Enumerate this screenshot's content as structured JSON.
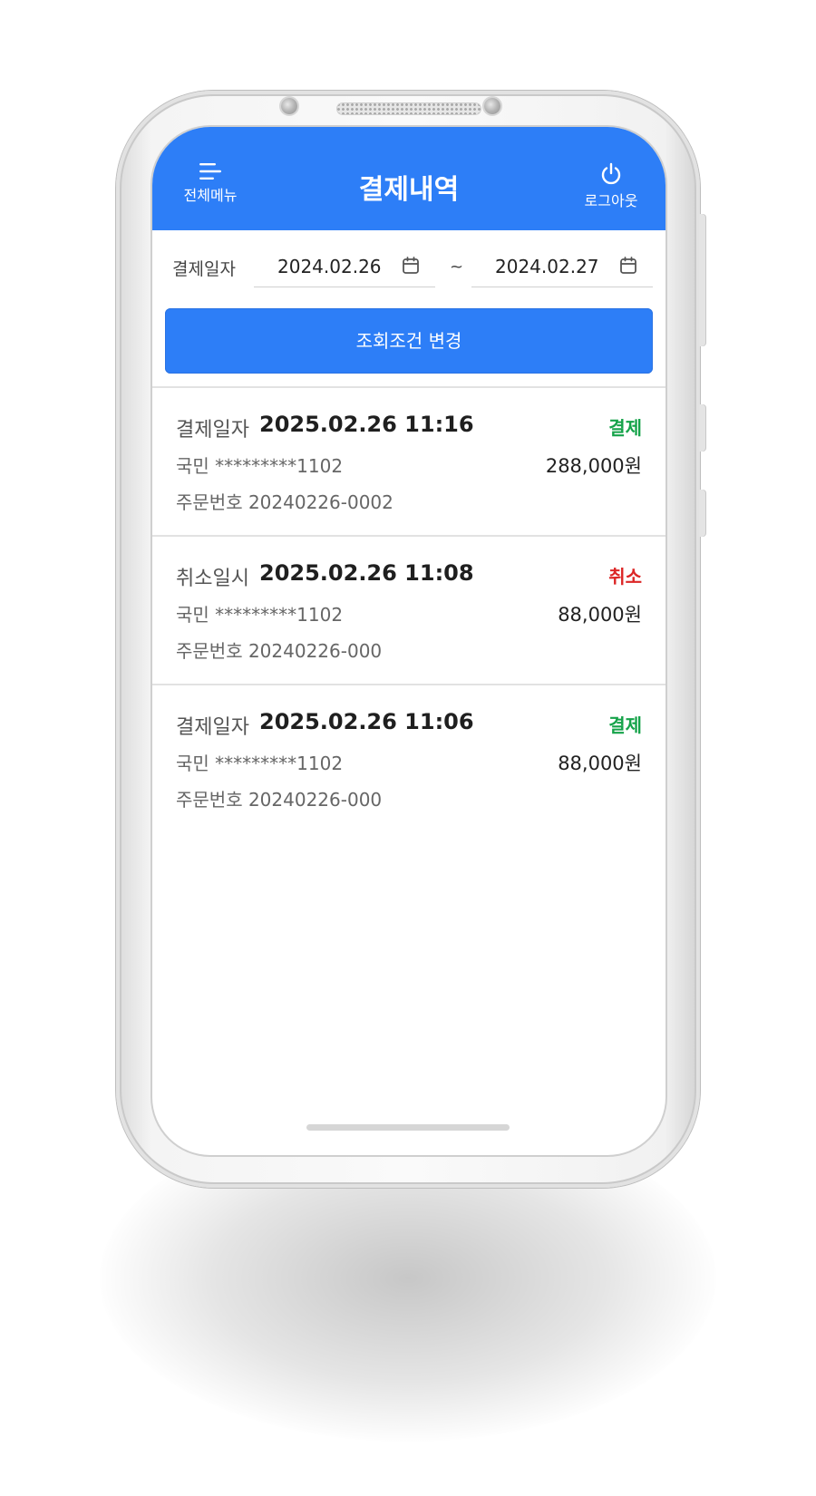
{
  "header": {
    "title": "결제내역",
    "menu_label": "전체메뉴",
    "logout_label": "로그아웃",
    "background_color": "#2d7ef7"
  },
  "filter": {
    "label": "결제일자",
    "date_from": "2024.02.26",
    "separator": "~",
    "date_to": "2024.02.27",
    "search_button_label": "조회조건 변경"
  },
  "transactions": [
    {
      "date_label": "결제일자",
      "datetime": "2025.02.26 11:16",
      "status": "결제",
      "status_color": "#16a34a",
      "card": "국민 *********1102",
      "amount": "288,000원",
      "order": "주문번호 20240226-0002"
    },
    {
      "date_label": "취소일시",
      "datetime": "2025.02.26 11:08",
      "status": "취소",
      "status_color": "#dc2626",
      "card": "국민 *********1102",
      "amount": "88,000원",
      "order": "주문번호 20240226-000"
    },
    {
      "date_label": "결제일자",
      "datetime": "2025.02.26 11:06",
      "status": "결제",
      "status_color": "#16a34a",
      "card": "국민 *********1102",
      "amount": "88,000원",
      "order": "주문번호 20240226-000"
    }
  ],
  "icons": {
    "menu": "menu-icon",
    "logout": "power-icon",
    "calendar": "calendar-icon"
  }
}
